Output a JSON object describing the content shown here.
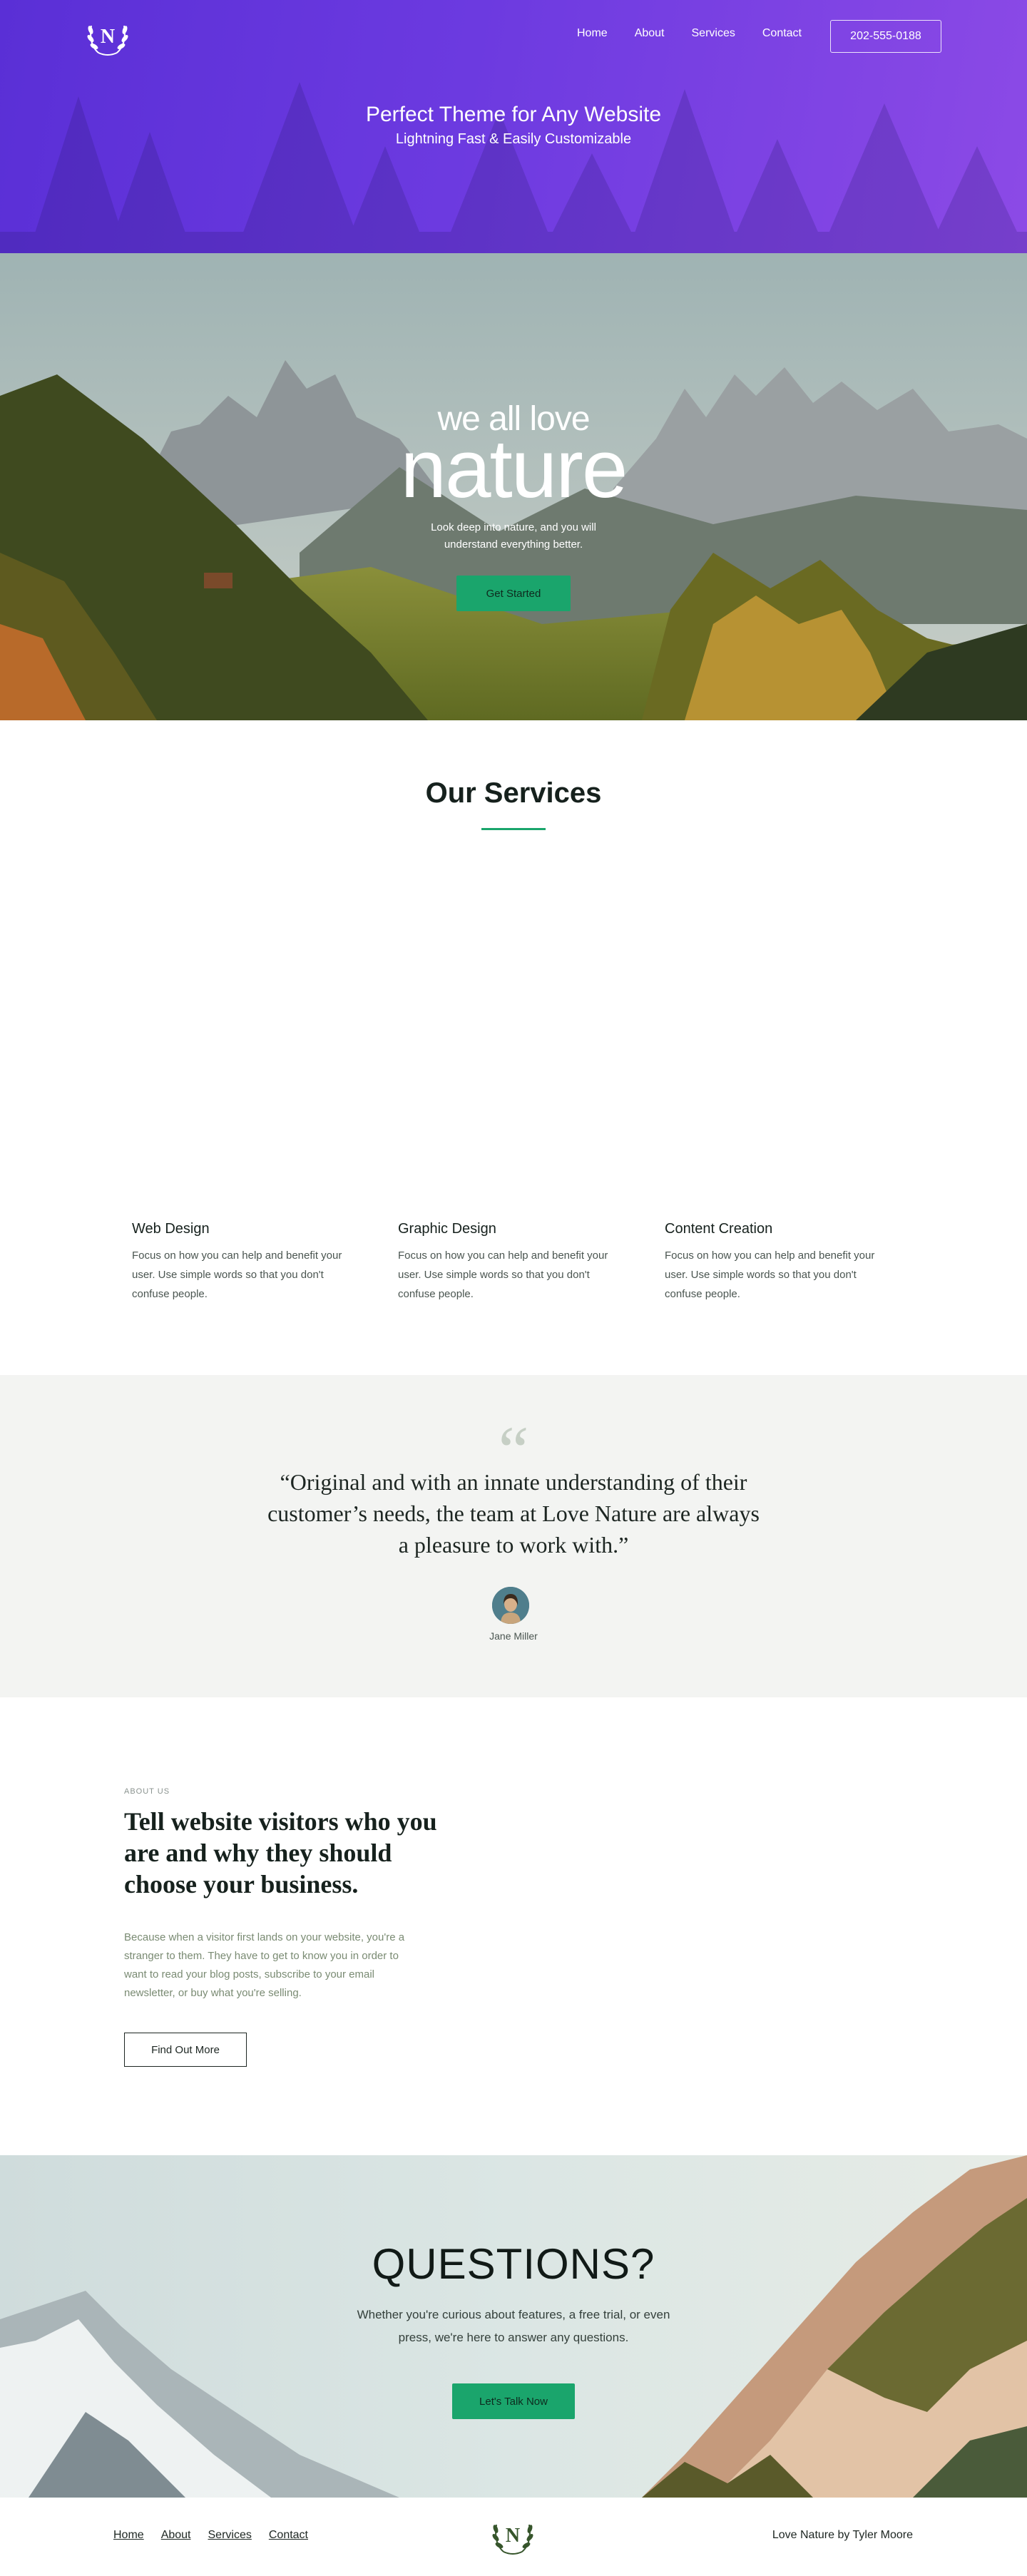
{
  "header": {
    "logo_letter": "N",
    "nav": [
      "Home",
      "About",
      "Services",
      "Contact"
    ],
    "phone": "202-555-0188",
    "title": "Perfect Theme for Any Website",
    "subtitle": "Lightning Fast & Easily Customizable"
  },
  "hero": {
    "kicker": "we all love",
    "title": "nature",
    "text": "Look deep into nature, and you will understand everything better.",
    "cta": "Get Started"
  },
  "services": {
    "heading": "Our Services",
    "items": [
      {
        "title": "Web Design",
        "text": "Focus on how you can help and benefit your user. Use simple words so that you don't confuse people."
      },
      {
        "title": "Graphic Design",
        "text": "Focus on how you can help and benefit your user. Use simple words so that you don't confuse people."
      },
      {
        "title": "Content Creation",
        "text": "Focus on how you can help and benefit your user. Use simple words so that you don't confuse people."
      }
    ]
  },
  "testimonial": {
    "mark": "“",
    "quote": "“Original and with an innate understanding of their customer’s needs, the team at Love Nature are always a pleasure to work with.”",
    "author": "Jane Miller"
  },
  "about": {
    "eyebrow": "ABOUT US",
    "heading": "Tell website visitors who you are and why they should choose your business.",
    "text": "Because when a visitor first lands on your website, you're a stranger to them. They have to get to know you in order to want to read your blog posts, subscribe to your email newsletter, or buy what you're selling.",
    "button": "Find Out More"
  },
  "questions": {
    "title": "QUESTIONS?",
    "text": "Whether you're curious about features, a free trial, or even press, we're here to answer any questions.",
    "cta": "Let's Talk Now"
  },
  "footer": {
    "nav": [
      "Home",
      "About",
      "Services",
      "Contact"
    ],
    "logo_letter": "N",
    "credit": "Love Nature by Tyler Moore"
  },
  "colors": {
    "banner_start": "#5a2fd6",
    "banner_end": "#8c4ae6",
    "accent_green": "#1aa56c",
    "testimonial_bg": "#f3f4f2"
  }
}
